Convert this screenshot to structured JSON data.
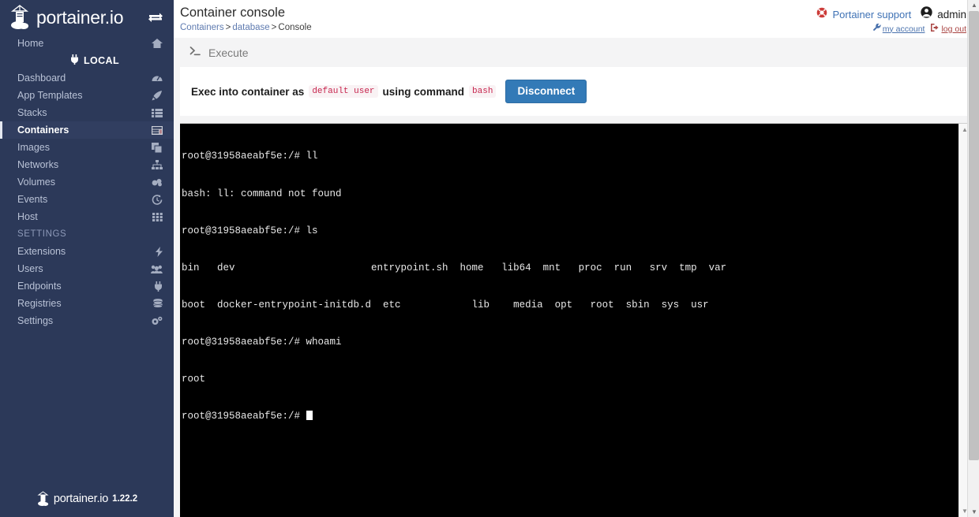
{
  "sidebar": {
    "brand": "portainer.io",
    "toggle_icon": "exchange-arrows-icon",
    "home": {
      "label": "Home",
      "icon": "home-icon"
    },
    "local_badge": {
      "label": "LOCAL",
      "icon": "plug-icon"
    },
    "items": [
      {
        "label": "Dashboard",
        "icon": "tachometer-icon",
        "active": false
      },
      {
        "label": "App Templates",
        "icon": "rocket-icon",
        "active": false
      },
      {
        "label": "Stacks",
        "icon": "list-icon",
        "active": false
      },
      {
        "label": "Containers",
        "icon": "containers-icon",
        "active": true
      },
      {
        "label": "Images",
        "icon": "clone-icon",
        "active": false
      },
      {
        "label": "Networks",
        "icon": "sitemap-icon",
        "active": false
      },
      {
        "label": "Volumes",
        "icon": "hdd-icon",
        "active": false
      },
      {
        "label": "Events",
        "icon": "history-icon",
        "active": false
      },
      {
        "label": "Host",
        "icon": "th-icon",
        "active": false
      }
    ],
    "settings_section": "SETTINGS",
    "settings_items": [
      {
        "label": "Extensions",
        "icon": "bolt-icon"
      },
      {
        "label": "Users",
        "icon": "users-icon"
      },
      {
        "label": "Endpoints",
        "icon": "plug-icon"
      },
      {
        "label": "Registries",
        "icon": "database-icon"
      },
      {
        "label": "Settings",
        "icon": "cogs-icon"
      }
    ],
    "footer": {
      "name": "portainer.io",
      "version": "1.22.2"
    }
  },
  "header": {
    "title": "Container console",
    "breadcrumb": [
      {
        "label": "Containers",
        "link": true
      },
      {
        "label": "database",
        "link": true
      },
      {
        "label": "Console",
        "link": false
      }
    ],
    "breadcrumb_sep": ">",
    "support_label": "Portainer support",
    "support_icon": "life-ring-icon",
    "user_name": "admin",
    "user_icon": "user-circle-icon",
    "my_account_label": "my account",
    "my_account_icon": "wrench-icon",
    "log_out_label": "log out",
    "log_out_icon": "sign-out-icon"
  },
  "execute_panel": {
    "header_label": "Execute",
    "header_icon": "terminal-prompt-icon",
    "exec_prefix": "Exec into container as",
    "exec_user": "default user",
    "exec_middle": "using command",
    "exec_command": "bash",
    "disconnect_label": "Disconnect"
  },
  "terminal": {
    "lines": [
      "root@31958aeabf5e:/# ll",
      "bash: ll: command not found",
      "root@31958aeabf5e:/# ls",
      "bin   dev                       entrypoint.sh  home   lib64  mnt   proc  run   srv  tmp  var",
      "boot  docker-entrypoint-initdb.d  etc            lib    media  opt   root  sbin  sys  usr",
      "root@31958aeabf5e:/# whoami",
      "root",
      "root@31958aeabf5e:/# "
    ],
    "scroll_up_icon": "caret-up-icon",
    "scroll_down_icon": "caret-down-icon"
  },
  "colors": {
    "sidebar_bg": "#2c3959",
    "accent_blue": "#337ab7",
    "code_pink": "#c7254e",
    "terminal_bg": "#000000",
    "link_blue": "#5f7bb0"
  }
}
